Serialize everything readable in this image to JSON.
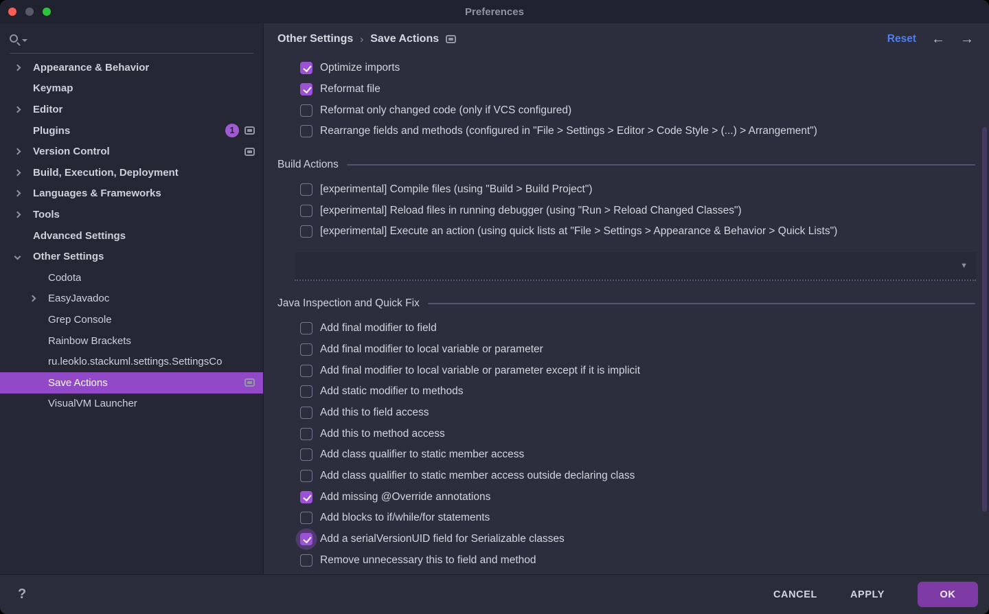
{
  "window": {
    "title": "Preferences"
  },
  "sidebar": {
    "items": [
      {
        "label": "Appearance & Behavior",
        "bold": true,
        "chevron": "right"
      },
      {
        "label": "Keymap",
        "bold": true
      },
      {
        "label": "Editor",
        "bold": true,
        "chevron": "right"
      },
      {
        "label": "Plugins",
        "bold": true,
        "badge": "1",
        "widget": true
      },
      {
        "label": "Version Control",
        "bold": true,
        "chevron": "right",
        "widget": true
      },
      {
        "label": "Build, Execution, Deployment",
        "bold": true,
        "chevron": "right"
      },
      {
        "label": "Languages & Frameworks",
        "bold": true,
        "chevron": "right"
      },
      {
        "label": "Tools",
        "bold": true,
        "chevron": "right"
      },
      {
        "label": "Advanced Settings",
        "bold": true
      },
      {
        "label": "Other Settings",
        "bold": true,
        "chevron": "down"
      },
      {
        "label": "Codota",
        "indent": 1
      },
      {
        "label": "EasyJavadoc",
        "indent": 1,
        "chevron": "right"
      },
      {
        "label": "Grep Console",
        "indent": 1
      },
      {
        "label": "Rainbow Brackets",
        "indent": 1
      },
      {
        "label": "ru.leoklo.stackuml.settings.SettingsCo",
        "indent": 1
      },
      {
        "label": "Save Actions",
        "indent": 1,
        "selected": true,
        "widget": true
      },
      {
        "label": "VisualVM Launcher",
        "indent": 1
      }
    ]
  },
  "header": {
    "section": "Other Settings",
    "page": "Save Actions",
    "reset_label": "Reset",
    "back_arrow": "←",
    "forward_arrow": "→"
  },
  "main": {
    "top_checkboxes": [
      {
        "label": "Optimize imports",
        "checked": true
      },
      {
        "label": "Reformat file",
        "checked": true
      },
      {
        "label": "Reformat only changed code (only if VCS configured)",
        "checked": false
      },
      {
        "label": "Rearrange fields and methods (configured in \"File > Settings > Editor > Code Style > (...) > Arrangement\")",
        "checked": false
      }
    ],
    "sections": [
      {
        "title": "Build Actions",
        "has_dropdown": true,
        "checkboxes": [
          {
            "label": "[experimental] Compile files (using \"Build > Build Project\")",
            "checked": false
          },
          {
            "label": "[experimental] Reload files in running debugger (using \"Run > Reload Changed Classes\")",
            "checked": false
          },
          {
            "label": "[experimental] Execute an action (using quick lists at \"File > Settings > Appearance & Behavior > Quick Lists\")",
            "checked": false
          }
        ]
      },
      {
        "title": "Java Inspection and Quick Fix",
        "has_dropdown": false,
        "checkboxes": [
          {
            "label": "Add final modifier to field",
            "checked": false
          },
          {
            "label": "Add final modifier to local variable or parameter",
            "checked": false
          },
          {
            "label": "Add final modifier to local variable or parameter except if it is implicit",
            "checked": false
          },
          {
            "label": "Add static modifier to methods",
            "checked": false
          },
          {
            "label": "Add this to field access",
            "checked": false
          },
          {
            "label": "Add this to method access",
            "checked": false
          },
          {
            "label": "Add class qualifier to static member access",
            "checked": false
          },
          {
            "label": "Add class qualifier to static member access outside declaring class",
            "checked": false
          },
          {
            "label": "Add missing @Override annotations",
            "checked": true
          },
          {
            "label": "Add blocks to if/while/for statements",
            "checked": false
          },
          {
            "label": "Add a serialVersionUID field for Serializable classes",
            "checked": true,
            "halo": true
          },
          {
            "label": "Remove unnecessary this to field and method",
            "checked": false
          }
        ]
      }
    ],
    "dropdown_caret": "▼"
  },
  "footer": {
    "help_label": "?",
    "cancel_label": "CANCEL",
    "apply_label": "APPLY",
    "ok_label": "OK"
  },
  "colors": {
    "accent_purple": "#9d52d6",
    "selected_row": "#9149c8",
    "ok_button": "#7e3ba5",
    "reset_blue": "#4d7ff2",
    "sidebar_bg": "#262734",
    "main_bg": "#2d2e3d",
    "titlebar_bg": "#21222f",
    "footer_bg": "#2b2c3a",
    "scrollbar_thumb": "#453a60"
  }
}
